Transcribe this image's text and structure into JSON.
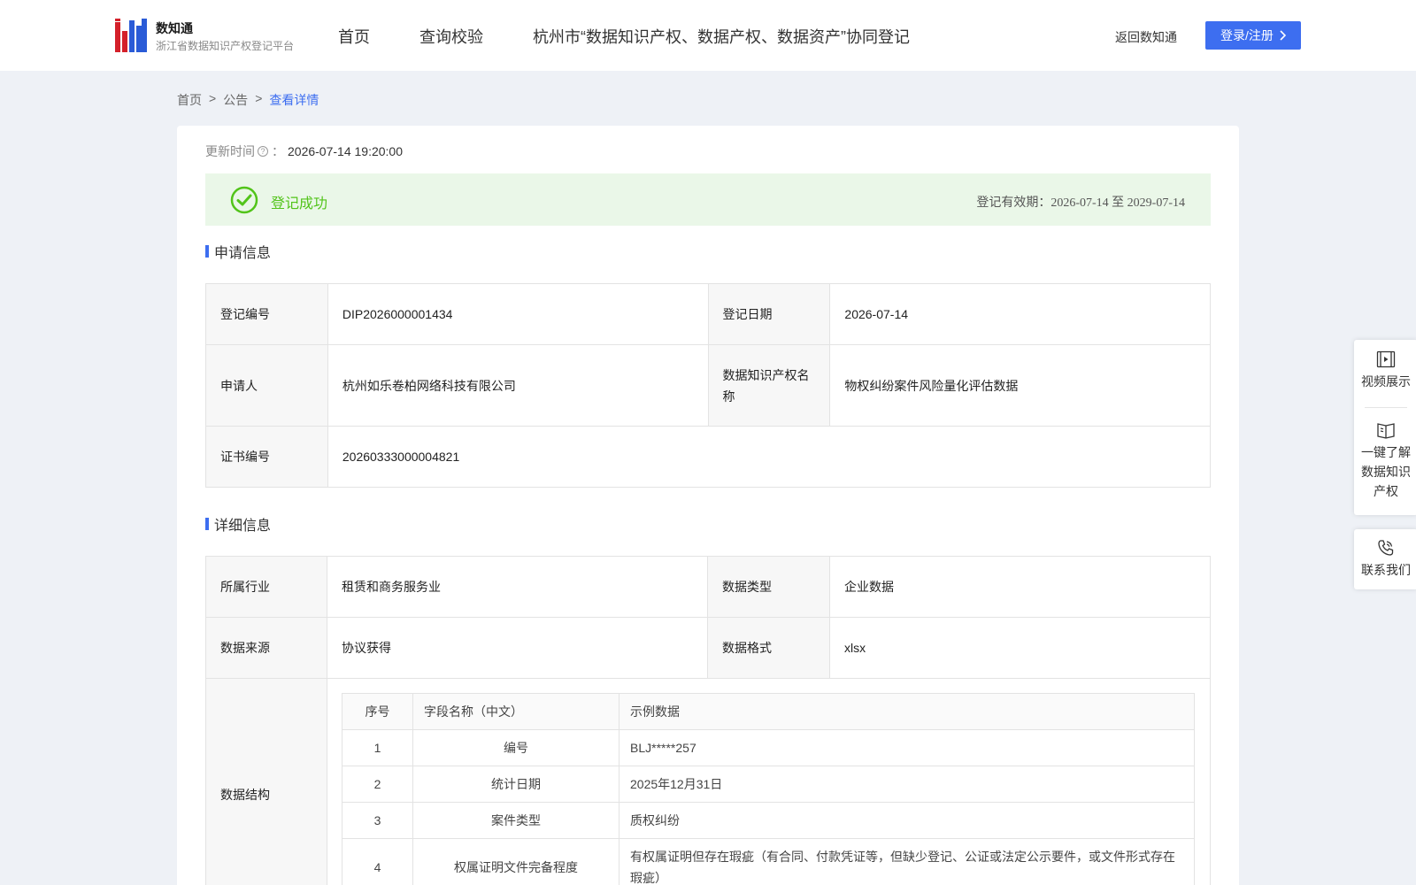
{
  "header": {
    "logo_name": "数知通",
    "logo_sub": "浙江省数据知识产权登记平台",
    "nav": [
      "首页",
      "查询校验",
      "杭州市“数据知识产权、数据产权、数据资产”协同登记"
    ],
    "back_label": "返回数知通",
    "login_label": "登录/注册"
  },
  "breadcrumb": [
    "首页",
    "公告",
    "查看详情"
  ],
  "update": {
    "label": "更新时间",
    "value": "2026-07-14 19:20:00"
  },
  "status": {
    "text": "登记成功",
    "validity": "登记有效期：2026-07-14 至 2029-07-14",
    "color": "#52c41a"
  },
  "apply_section": {
    "title": "申请信息",
    "reg_no_label": "登记编号",
    "reg_no": "DIP2026000001434",
    "reg_date_label": "登记日期",
    "reg_date": "2026-07-14",
    "applicant_label": "申请人",
    "applicant": "杭州如乐卷柏网络科技有限公司",
    "ip_name_label": "数据知识产权名称",
    "ip_name": "物权纠纷案件风险量化评估数据",
    "cert_label": "证书编号",
    "cert_no": "20260333000004821"
  },
  "detail_section": {
    "title": "详细信息",
    "industry_label": "所属行业",
    "industry": "租赁和商务服务业",
    "type_label": "数据类型",
    "type": "企业数据",
    "source_label": "数据来源",
    "source": "协议获得",
    "format_label": "数据格式",
    "format": "xlsx",
    "structure_label": "数据结构",
    "fields_headers": [
      "序号",
      "字段名称（中文）",
      "示例数据"
    ],
    "fields": [
      {
        "no": "1",
        "name": "编号",
        "sample": "BLJ*****257"
      },
      {
        "no": "2",
        "name": "统计日期",
        "sample": "2025年12月31日"
      },
      {
        "no": "3",
        "name": "案件类型",
        "sample": "质权纠纷"
      },
      {
        "no": "4",
        "name": "权属证明文件完备程度",
        "sample": "有权属证明但存在瑕疵（有合同、付款凭证等，但缺少登记、公证或法定公示要件，或文件形式存在瑕疵）"
      }
    ]
  },
  "side_panel": {
    "video": "视频展示",
    "learn": "一键了解数据知识产权",
    "contact": "联系我们"
  },
  "colors": {
    "accent": "#3d6ef0",
    "success_bg": "#eaf7e8"
  }
}
